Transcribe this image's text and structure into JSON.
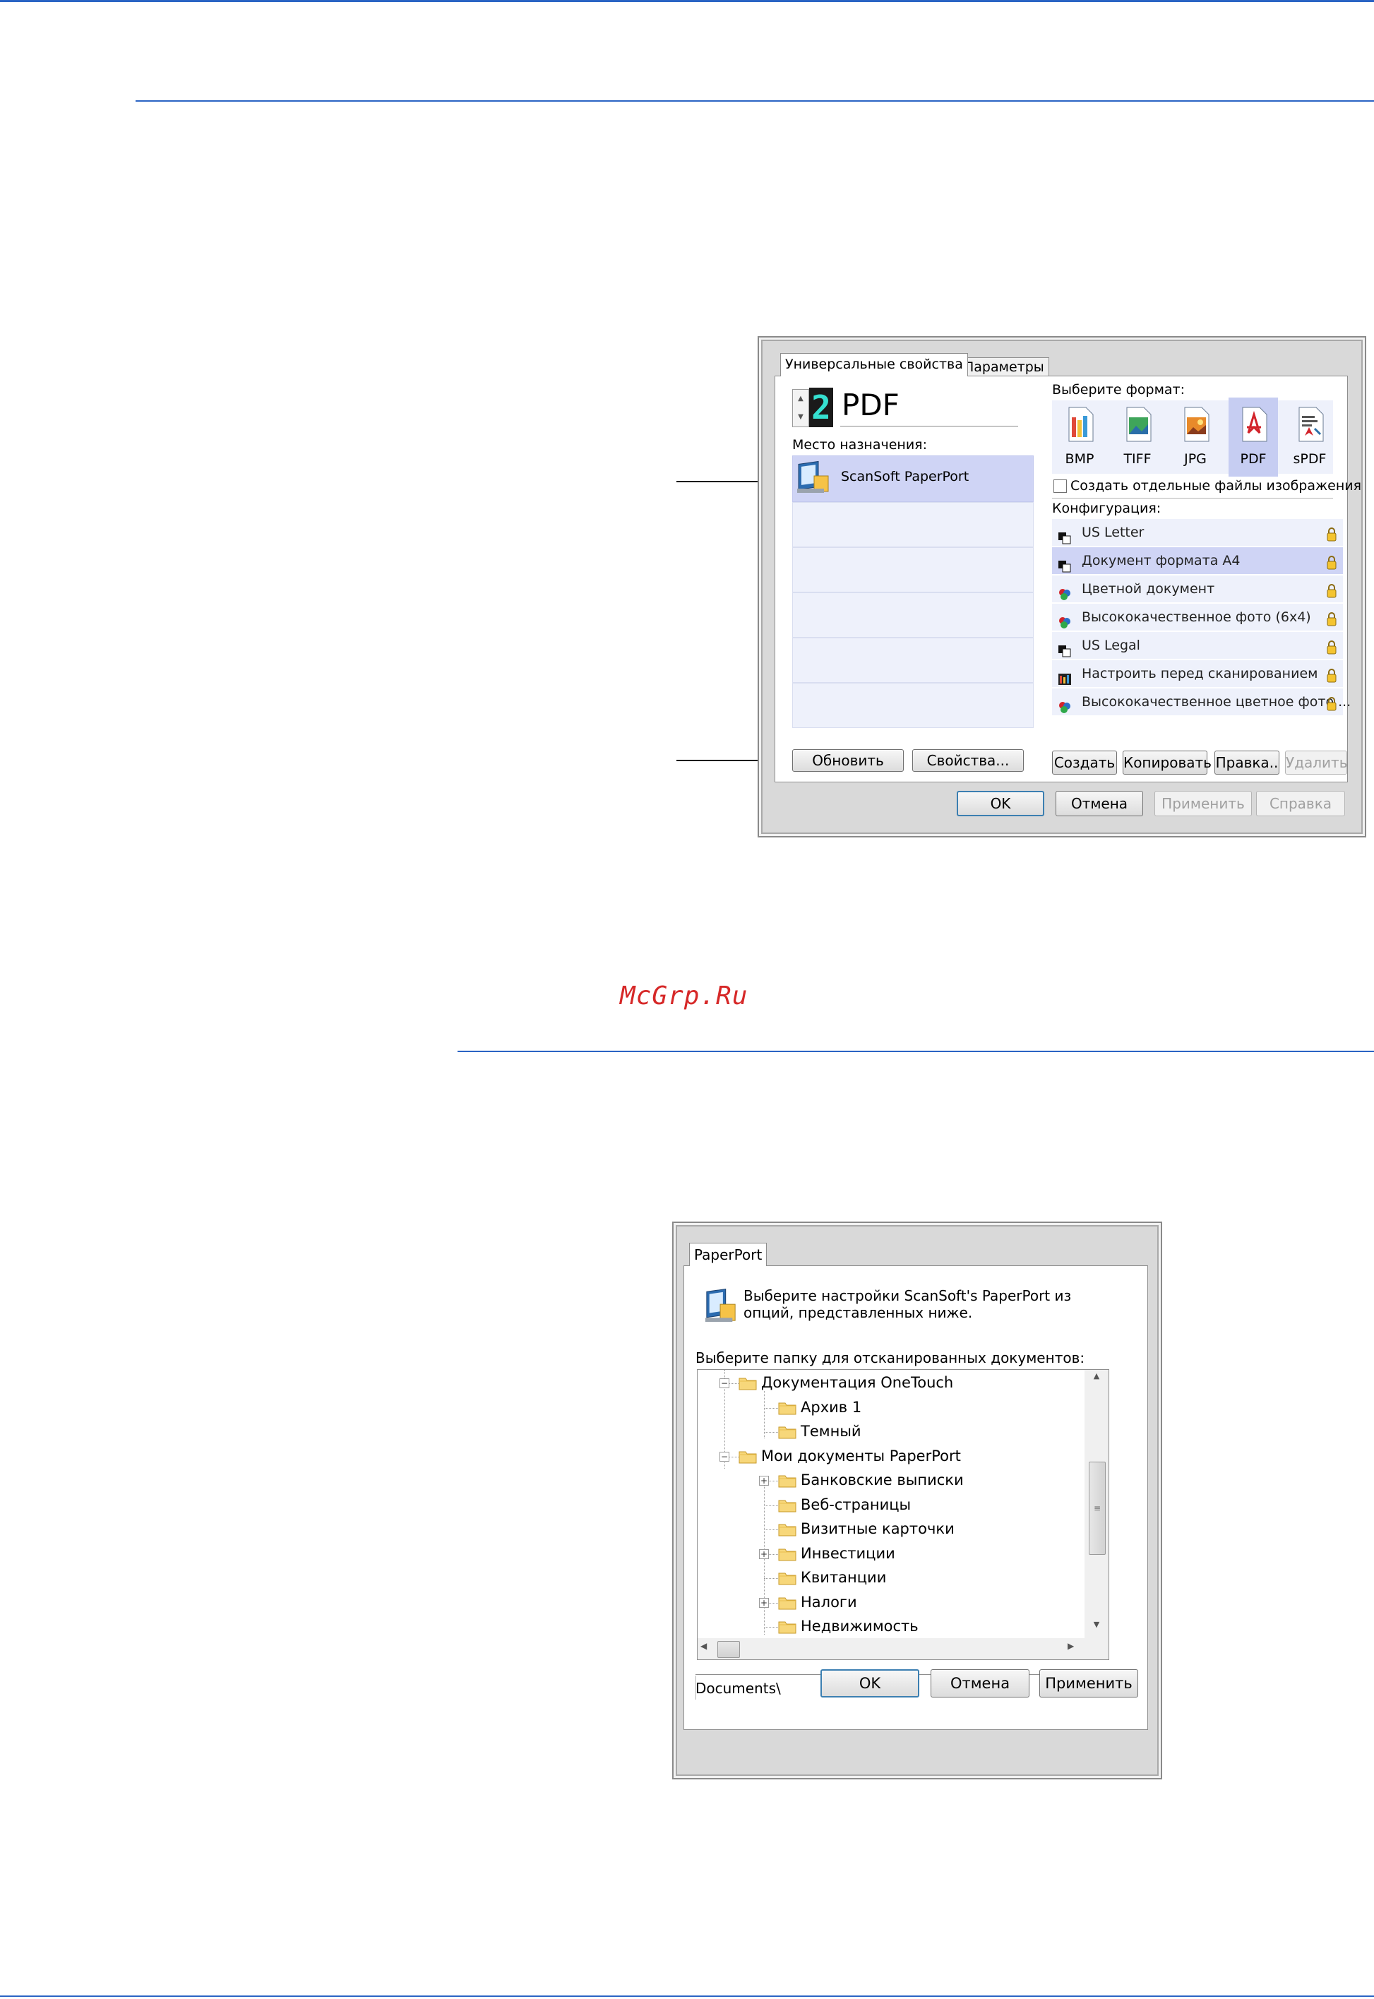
{
  "dialog1": {
    "tabs": [
      "Универсальные свойства",
      "Параметры"
    ],
    "stepper_value": "2",
    "format_title": "PDF",
    "destination_label": "Место назначения:",
    "destination_item": "ScanSoft PaperPort",
    "select_format_label": "Выберите формат:",
    "formats": [
      "BMP",
      "TIFF",
      "JPG",
      "PDF",
      "sPDF"
    ],
    "selected_format": "PDF",
    "separate_files_label": "Создать отдельные файлы изображения",
    "config_label": "Конфигурация:",
    "configs": [
      {
        "label": "US Letter",
        "icon": "bw-doc-icon",
        "selected": false
      },
      {
        "label": "Документ формата A4",
        "icon": "bw-doc-icon",
        "selected": true
      },
      {
        "label": "Цветной документ",
        "icon": "color-doc-icon",
        "selected": false
      },
      {
        "label": "Высококачественное фото (6x4)",
        "icon": "color-doc-icon",
        "selected": false
      },
      {
        "label": "US Legal",
        "icon": "bw-doc-icon",
        "selected": false
      },
      {
        "label": "Настроить перед сканированием",
        "icon": "configure-icon",
        "selected": false
      },
      {
        "label": "Высококачественное цветное фото ...",
        "icon": "color-doc-icon",
        "selected": false
      }
    ],
    "buttons": {
      "refresh": "Обновить",
      "properties": "Свойства...",
      "create": "Создать",
      "copy": "Копировать",
      "edit": "Правка..",
      "delete": "Удалить",
      "ok": "OK",
      "cancel": "Отмена",
      "apply": "Применить",
      "help": "Справка"
    }
  },
  "watermark": "McGrp.Ru",
  "dialog2": {
    "tab": "PaperPort",
    "intro": [
      "Выберите настройки ScanSoft's PaperPort из",
      "опций, представленных ниже."
    ],
    "folder_label": "Выберите папку для отсканированных документов:",
    "tree": [
      {
        "label": "Документация OneTouch",
        "level": 0,
        "toggle": "minus"
      },
      {
        "label": "Архив 1",
        "level": 1,
        "toggle": ""
      },
      {
        "label": "Темный",
        "level": 1,
        "toggle": ""
      },
      {
        "label": "Мои документы PaperPort",
        "level": 0,
        "toggle": "minus"
      },
      {
        "label": "Банковские выписки",
        "level": 1,
        "toggle": "plus"
      },
      {
        "label": "Веб-страницы",
        "level": 1,
        "toggle": ""
      },
      {
        "label": "Визитные карточки",
        "level": 1,
        "toggle": ""
      },
      {
        "label": "Инвестиции",
        "level": 1,
        "toggle": "plus"
      },
      {
        "label": "Квитанции",
        "level": 1,
        "toggle": ""
      },
      {
        "label": "Налоги",
        "level": 1,
        "toggle": "plus"
      },
      {
        "label": "Недвижимость",
        "level": 1,
        "toggle": ""
      }
    ],
    "path": "Documents\\",
    "buttons": {
      "ok": "OK",
      "cancel": "Отмена",
      "apply": "Применить"
    }
  },
  "colors": {
    "rule": "#2a64c4",
    "selection": "#cfd4f5",
    "row_bg": "#eef1fb"
  }
}
